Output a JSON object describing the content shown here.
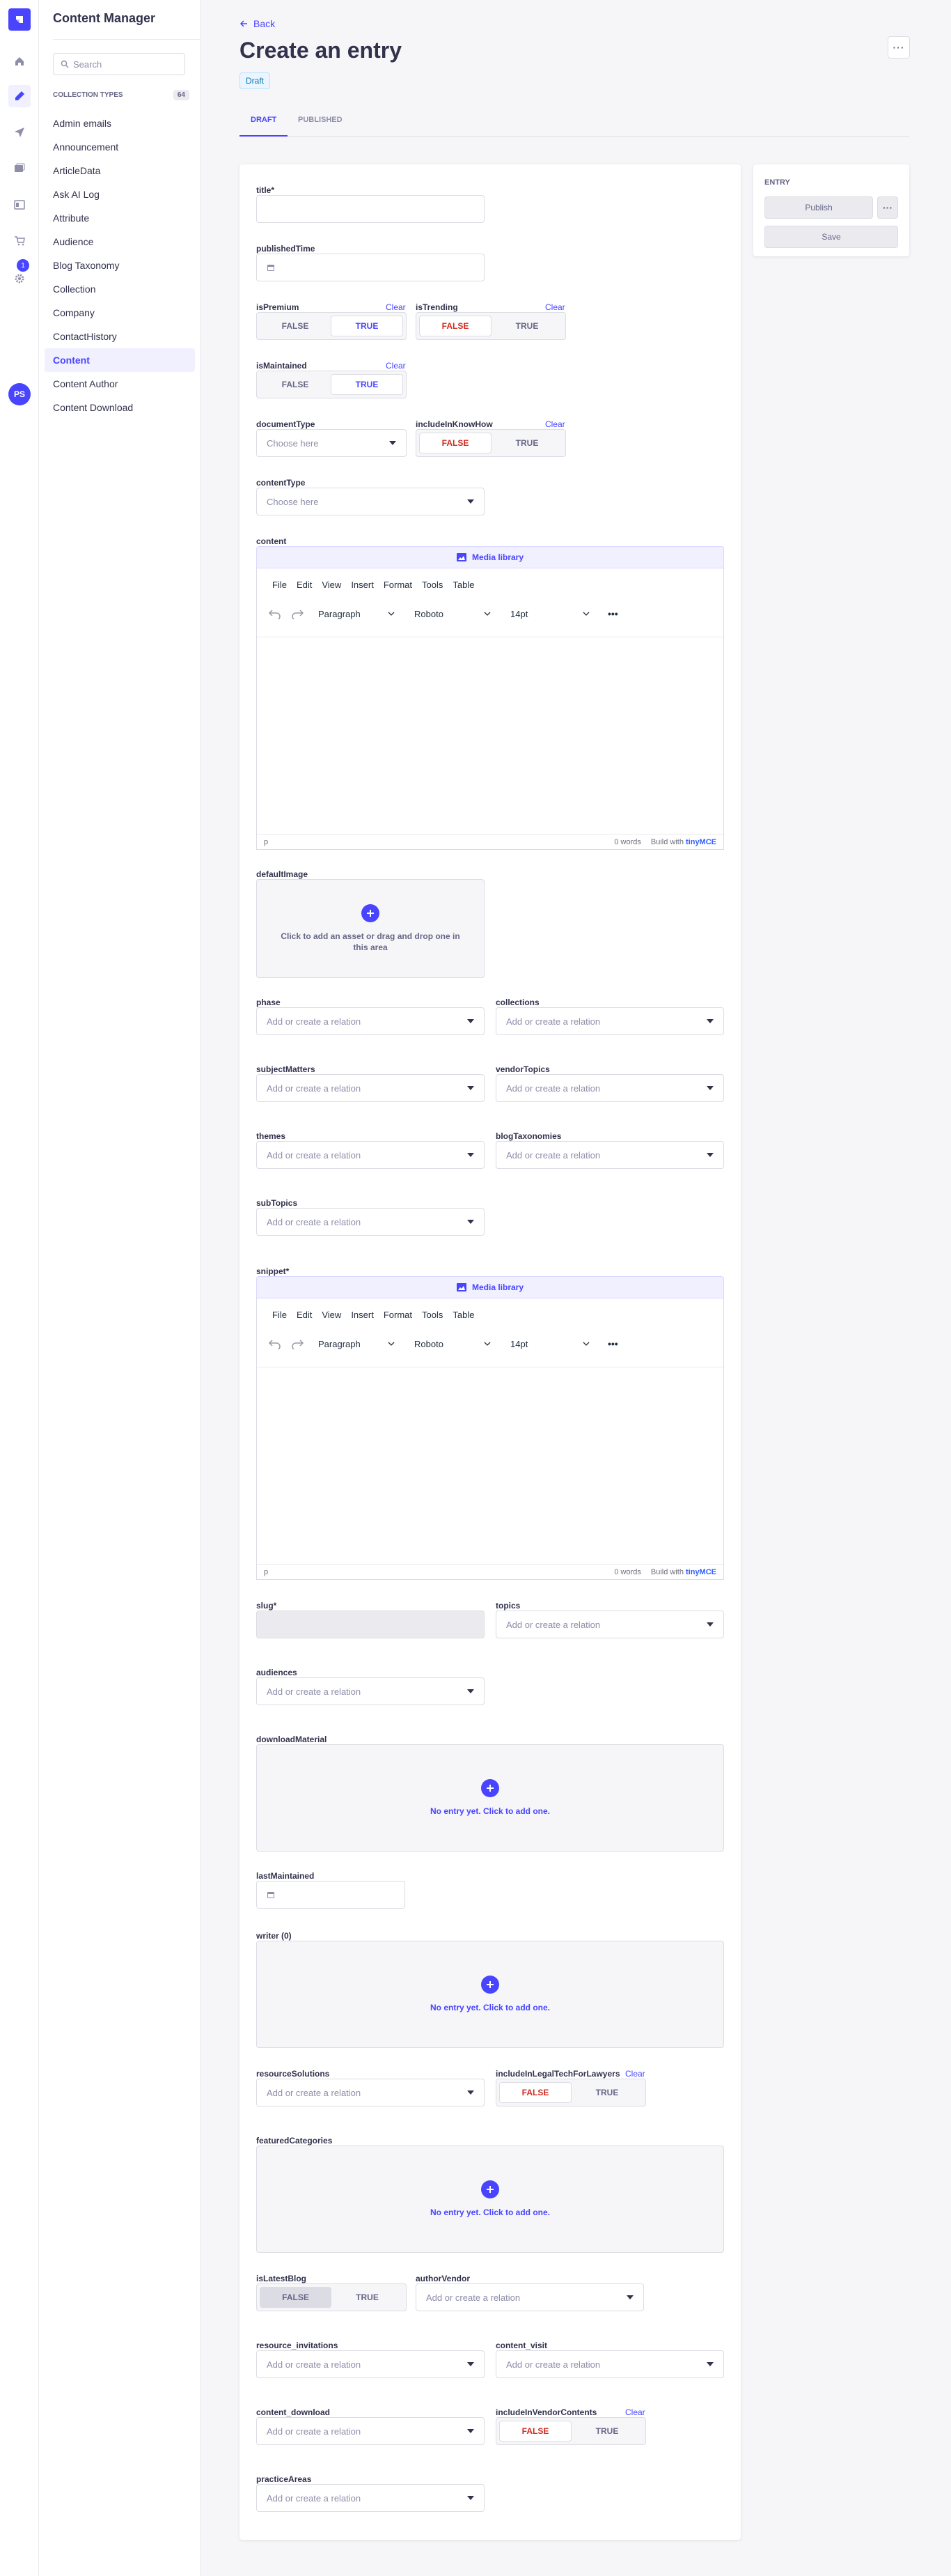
{
  "app": {
    "title": "Content Manager",
    "avatar_initials": "PS",
    "notification_count": "1"
  },
  "rail": {
    "icons": [
      "strapi-logo-icon",
      "home-icon",
      "content-manager-icon",
      "send-icon",
      "media-library-icon",
      "content-type-builder-icon",
      "shopping-cart-icon",
      "settings-icon"
    ]
  },
  "sidebar": {
    "search_placeholder": "Search",
    "section_label": "COLLECTION TYPES",
    "section_count": "64",
    "items": [
      {
        "label": "Admin emails"
      },
      {
        "label": "Announcement"
      },
      {
        "label": "ArticleData"
      },
      {
        "label": "Ask AI Log"
      },
      {
        "label": "Attribute"
      },
      {
        "label": "Audience"
      },
      {
        "label": "Blog Taxonomy"
      },
      {
        "label": "Collection"
      },
      {
        "label": "Company"
      },
      {
        "label": "ContactHistory"
      },
      {
        "label": "Content"
      },
      {
        "label": "Content Author"
      },
      {
        "label": "Content Download"
      }
    ],
    "active_item": "Content"
  },
  "header": {
    "back_label": "Back",
    "title": "Create an entry",
    "status": "Draft",
    "more_label": "···"
  },
  "tabs": [
    {
      "label": "DRAFT"
    },
    {
      "label": "PUBLISHED"
    }
  ],
  "entry_panel": {
    "label": "ENTRY",
    "publish_label": "Publish",
    "more_label": "···",
    "save_label": "Save"
  },
  "common": {
    "clear": "Clear",
    "true": "TRUE",
    "false": "FALSE",
    "choose": "Choose here",
    "relation_placeholder": "Add or create a relation",
    "media_library": "Media library",
    "no_entry": "No entry yet. Click to add one."
  },
  "fields": {
    "title": {
      "label": "title*"
    },
    "publishedTime": {
      "label": "publishedTime"
    },
    "isPremium": {
      "label": "isPremium"
    },
    "isTrending": {
      "label": "isTrending"
    },
    "isMaintained": {
      "label": "isMaintained"
    },
    "documentType": {
      "label": "documentType"
    },
    "includeInKnowHow": {
      "label": "includeInKnowHow"
    },
    "contentType": {
      "label": "contentType"
    },
    "content": {
      "label": "content"
    },
    "defaultImage": {
      "label": "defaultImage",
      "hint": "Click to add an asset or drag and drop one in this area"
    },
    "phase": {
      "label": "phase"
    },
    "collections": {
      "label": "collections"
    },
    "subjectMatters": {
      "label": "subjectMatters"
    },
    "vendorTopics": {
      "label": "vendorTopics"
    },
    "themes": {
      "label": "themes"
    },
    "blogTaxonomies": {
      "label": "blogTaxonomies"
    },
    "subTopics": {
      "label": "subTopics"
    },
    "snippet": {
      "label": "snippet*"
    },
    "slug": {
      "label": "slug*"
    },
    "topics": {
      "label": "topics"
    },
    "audiences": {
      "label": "audiences"
    },
    "downloadMaterial": {
      "label": "downloadMaterial"
    },
    "lastMaintained": {
      "label": "lastMaintained"
    },
    "writer": {
      "label": "writer (0)"
    },
    "resourceSolutions": {
      "label": "resourceSolutions"
    },
    "includeInLegalTechForLawyers": {
      "label": "includeInLegalTechForLawyers"
    },
    "featuredCategories": {
      "label": "featuredCategories"
    },
    "isLatestBlog": {
      "label": "isLatestBlog"
    },
    "authorVendor": {
      "label": "authorVendor"
    },
    "resource_invitations": {
      "label": "resource_invitations"
    },
    "content_visit": {
      "label": "content_visit"
    },
    "content_download": {
      "label": "content_download"
    },
    "includeInVendorContents": {
      "label": "includeInVendorContents"
    },
    "practiceAreas": {
      "label": "practiceAreas"
    }
  },
  "editor": {
    "menu": [
      "File",
      "Edit",
      "View",
      "Insert",
      "Format",
      "Tools",
      "Table"
    ],
    "block_format": "Paragraph",
    "font_family": "Roboto",
    "font_size": "14pt",
    "more": "•••",
    "path": "p",
    "word_count": "0 words",
    "built_with": "Build with",
    "brand": "tinyMCE"
  }
}
